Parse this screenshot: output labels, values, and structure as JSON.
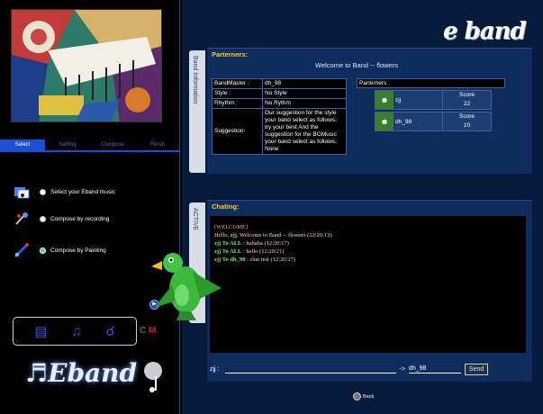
{
  "left": {
    "tabs": [
      {
        "label": "Select",
        "active": true
      },
      {
        "label": "Setting",
        "active": false
      },
      {
        "label": "Compose",
        "active": false
      },
      {
        "label": "Finish",
        "active": false
      }
    ],
    "options": [
      {
        "label": "Select your Eband music",
        "selected": false
      },
      {
        "label": "Compose by recording",
        "selected": false
      },
      {
        "label": "Compose by Painting",
        "selected": true
      }
    ],
    "letters": {
      "c": "C",
      "m": "M"
    },
    "logo": "Eband"
  },
  "right": {
    "logo": "e band",
    "side_tabs": {
      "info": "Band Information",
      "active": "ACTIVE"
    },
    "partners_title": "Parterners:",
    "welcome": "Welcome to Band -- flowers",
    "band_info": {
      "bandmaster_label": "BandMaster :",
      "bandmaster": "dh_98",
      "style_label": "Style :",
      "style": "No Style",
      "rhythm_label": "Rhythm :",
      "rhythm": "No Rythm",
      "suggestion_label": "Suggestion:",
      "suggestion": "Our suggestion for the style your band select as follows: try your best And the suggestion for the BGMusic your band select as follows: None"
    },
    "partners": {
      "header": "Parterners :",
      "score_label": "Score",
      "list": [
        {
          "name": "zjj",
          "score": "22"
        },
        {
          "name": "dh_98",
          "score": "10"
        }
      ]
    },
    "chat_title": "Chating:",
    "chat": {
      "system": "[WELCOME]",
      "welcome_prefix": "Hello, ",
      "welcome_user": "zjj",
      "welcome_suffix": ", Welcome to Band -- flowers",
      "welcome_time": "(12:20:13)",
      "messages": [
        {
          "from": "zjj",
          "to_word": " To ",
          "to": "ALL",
          "text": " : hahaha",
          "time": " (12:20:17)"
        },
        {
          "from": "zjj",
          "to_word": " To ",
          "to": "ALL",
          "text": " : hello",
          "time": " (12:20:21)"
        },
        {
          "from": "zjj",
          "to_word": " To ",
          "to": "dh_98",
          "text": " : chat test",
          "time": " (12:20:27)"
        }
      ],
      "input_label": "zjj :",
      "input_value": "",
      "arrow": "->",
      "target": "dh_98",
      "send": "Send"
    },
    "back": "Back"
  }
}
